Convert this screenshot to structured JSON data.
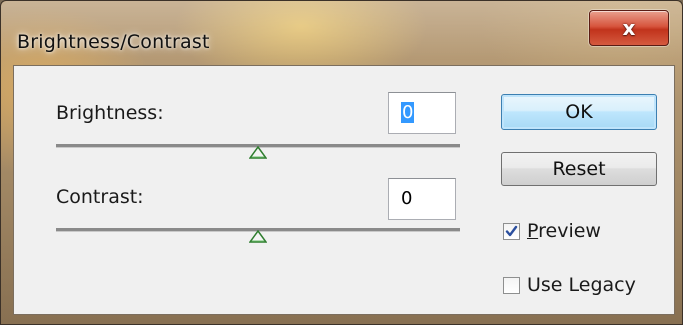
{
  "window": {
    "title": "Brightness/Contrast",
    "close_glyph": "x"
  },
  "brightness": {
    "label": "Brightness:",
    "value": "0",
    "slider_level": 0.5
  },
  "contrast": {
    "label": "Contrast:",
    "value": "0",
    "slider_level": 0.5
  },
  "buttons": {
    "ok": "OK",
    "reset": "Reset"
  },
  "options": {
    "preview": {
      "label": "Preview",
      "checked": true
    },
    "use_legacy": {
      "label": "Use Legacy",
      "checked": false
    }
  },
  "colors": {
    "accent": "#3399ff",
    "thumb_green": "#3a8f3a",
    "close_red": "#c1331c"
  }
}
